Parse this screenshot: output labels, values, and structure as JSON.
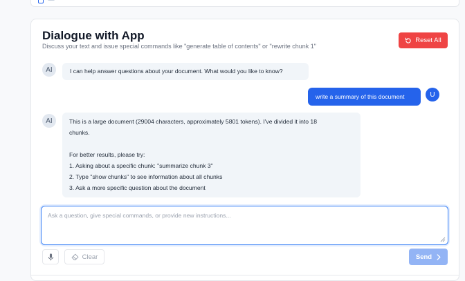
{
  "panel": {
    "title": "Dialogue with App",
    "subtitle": "Discuss your text and issue special commands like \"generate table of contents\" or \"rewrite chunk 1\"",
    "reset_label": "Reset All"
  },
  "messages": [
    {
      "role": "ai",
      "avatar": "AI",
      "lines": [
        "I can help answer questions about your document. What would you like to know?"
      ]
    },
    {
      "role": "user",
      "avatar": "U",
      "lines": [
        "write a summary of this document"
      ]
    },
    {
      "role": "ai",
      "avatar": "AI",
      "lines": [
        "This is a large document (29004 characters, approximately 5801 tokens). I've divided it into 18",
        "chunks.",
        "",
        "For better results, please try:",
        "1. Asking about a specific chunk: \"summarize chunk 3\"",
        "2. Type \"show chunks\" to see information about all chunks",
        "3. Ask a more specific question about the document"
      ]
    }
  ],
  "composer": {
    "placeholder": "Ask a question, give special commands, or provide new instructions...",
    "value": "",
    "clear_label": "Clear",
    "send_label": "Send"
  },
  "icons": {
    "reset": "refresh-icon",
    "mic": "microphone-icon",
    "clear": "eraser-icon",
    "send": "chevron-right-icon"
  },
  "colors": {
    "accent": "#2563eb",
    "danger": "#ef4444",
    "send_disabled": "#93b4f5",
    "ai_bubble": "#f1f5f9"
  }
}
